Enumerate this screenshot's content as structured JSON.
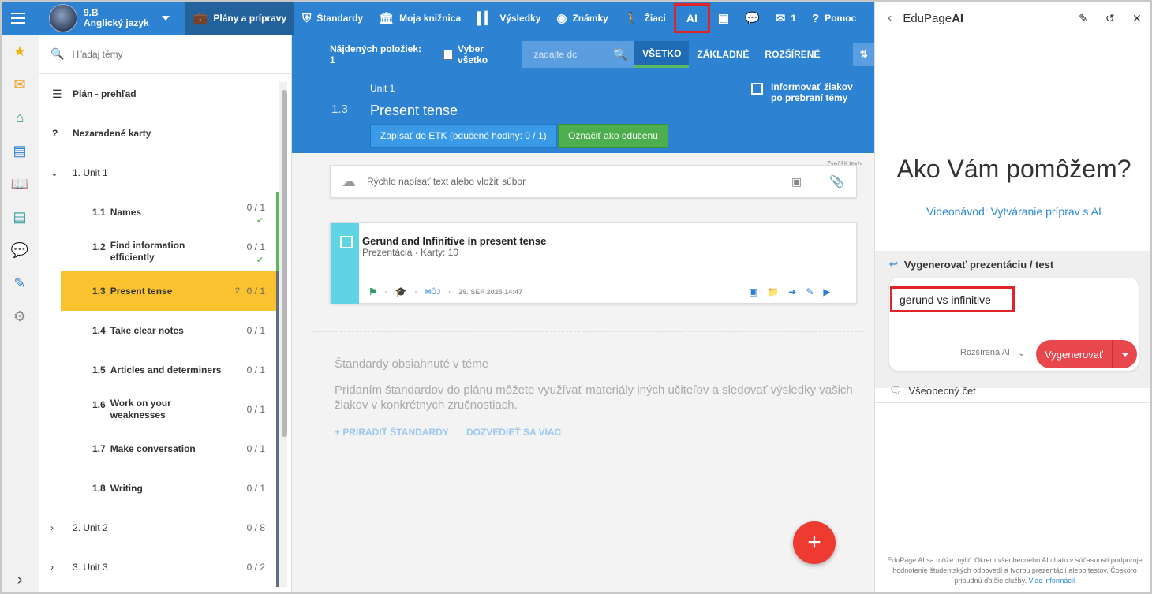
{
  "topbar": {
    "class_code": "9.B",
    "class_subject": "Anglický jazyk",
    "nav": [
      {
        "label": "Plány a prípravy",
        "icon": "briefcase-icon"
      },
      {
        "label": "Štandardy",
        "icon": "shield-icon"
      },
      {
        "label": "Moja knižnica",
        "icon": "library-icon"
      },
      {
        "label": "Výsledky",
        "icon": "bar-chart-icon"
      },
      {
        "label": "Známky",
        "icon": "grades-icon"
      },
      {
        "label": "Žiaci",
        "icon": "students-icon"
      },
      {
        "label": "AI",
        "icon": "ai-icon"
      },
      {
        "label": "",
        "icon": "cast-icon"
      },
      {
        "label": "",
        "icon": "chat-icon"
      },
      {
        "label": "1",
        "icon": "mail-icon"
      },
      {
        "label": "Pomoc",
        "icon": "help-icon"
      }
    ]
  },
  "topics": {
    "search_placeholder": "Hľadaj témy",
    "overview": "Plán - prehľad",
    "unsorted": "Nezaradené karty",
    "unit1": "1. Unit 1",
    "items": [
      {
        "num": "1.1",
        "title": "Names",
        "count": "0 / 1",
        "done": true
      },
      {
        "num": "1.2",
        "title": "Find information efficiently",
        "count": "0 / 1",
        "done": true
      },
      {
        "num": "1.3",
        "title": "Present tense",
        "count": "0 / 1",
        "badge": "2"
      },
      {
        "num": "1.4",
        "title": "Take clear notes",
        "count": "0 / 1"
      },
      {
        "num": "1.5",
        "title": "Articles and determiners",
        "count": "0 / 1"
      },
      {
        "num": "1.6",
        "title": "Work on your weaknesses",
        "count": "0 / 1"
      },
      {
        "num": "1.7",
        "title": "Make conversation",
        "count": "0 / 1"
      },
      {
        "num": "1.8",
        "title": "Writing",
        "count": "0 / 1"
      }
    ],
    "units": [
      {
        "label": "2. Unit 2",
        "count": "0 / 8"
      },
      {
        "label": "3. Unit 3",
        "count": "0 / 2"
      }
    ]
  },
  "main": {
    "found_label": "Nájdených položiek: 1",
    "select_all": "Vyber všetko",
    "search_placeholder": "zadajte dc",
    "tabs": [
      "VŠETKO",
      "ZÁKLADNÉ",
      "ROZŠÍRENÉ"
    ],
    "unit_label": "Unit 1",
    "topic_num": "1.3",
    "topic_title": "Present tense",
    "notify_label": "Informovať žiakov po prebraní témy",
    "etk_button": "Zapísať do ETK (odučené hodiny: 0 / 1)",
    "done_button": "Označiť ako odučenú",
    "hidden_label": "Zvečšiť texty",
    "quick_placeholder": "Rýchlo napísať text alebo vložiť súbor",
    "card": {
      "title": "Gerund and Infinitive in present tense",
      "subtitle": "Prezentácia · Karty: 10",
      "owner": "MÔJ",
      "date": "29. SEP 2025 14:47"
    },
    "standards": {
      "heading": "Štandardy obsiahnuté v téme",
      "text": "Pridaním štandardov do plánu môžete využívať materiály iných učiteľov a sledovať výsledky vašich žiakov v konkrétnych zručnostiach.",
      "assign": "+ PRIRADIŤ ŠTANDARDY",
      "more": "DOZVEDIEŤ SA VIAC"
    }
  },
  "ai": {
    "title_prefix": "EduPage",
    "title_suffix": "AI",
    "heading": "Ako Vám pomôžem?",
    "video_link": "Videonávod: Vytváranie príprav s AI",
    "gen_label": "Vygenerovať prezentáciu / test",
    "prompt": "gerund vs infinitive",
    "mode": "Rozšírená AI",
    "generate_button": "Vygenerovať",
    "chat_label": "Všeobecný čet",
    "disclaimer": "EduPage AI sa môže mýliť. Okrem všeobecného AI chatu v súčasnosti podporuje hodnotenie študentských odpovedí a tvorbu prezentácií alebo testov. Čoskoro pribudnú ďalšie služby.",
    "disclaimer_link": "Viac informácií"
  },
  "colors": {
    "primary": "#2d82d2",
    "active_topic": "#f9c22e",
    "success": "#4cae4c",
    "danger": "#e8474e",
    "highlight_box": "#e0252a"
  }
}
